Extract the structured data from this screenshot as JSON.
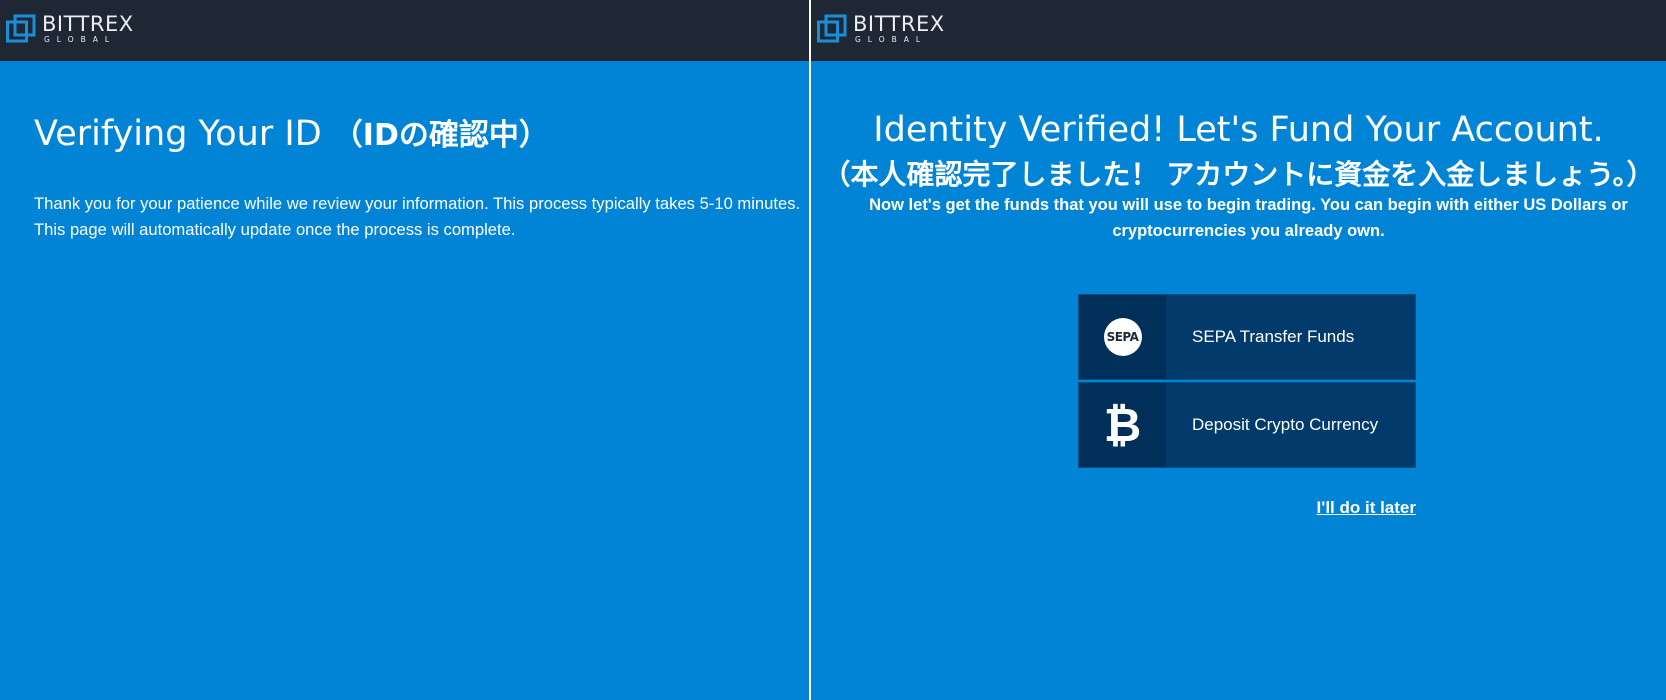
{
  "brand": {
    "name": "BITTREX",
    "sub": "GLOBAL"
  },
  "left": {
    "title": "Verifying Your ID",
    "title_jp": "（IDの確認中）",
    "description": "Thank you for your patience while we review your information. This process typically takes 5-10 minutes. This page will automatically update once the process is complete."
  },
  "right": {
    "title": "Identity Verified! Let's Fund Your Account.",
    "title_jp": "（本人確認完了しました！ アカウントに資金を入金しましょう。）",
    "description": "Now let's get the funds that you will use to begin trading. You can begin with either US Dollars or cryptocurrencies you already own.",
    "options": [
      {
        "label": "SEPA Transfer Funds",
        "icon": "sepa-icon",
        "icon_text": "SEPA"
      },
      {
        "label": "Deposit Crypto Currency",
        "icon": "bitcoin-icon",
        "icon_text": "₿"
      }
    ],
    "later_link": "I'll do it later"
  },
  "colors": {
    "background": "#0184d6",
    "header": "#1e2733",
    "button": "#013a6b",
    "button_icon_area": "#002f59",
    "logo_accent": "#1a8fd8"
  }
}
